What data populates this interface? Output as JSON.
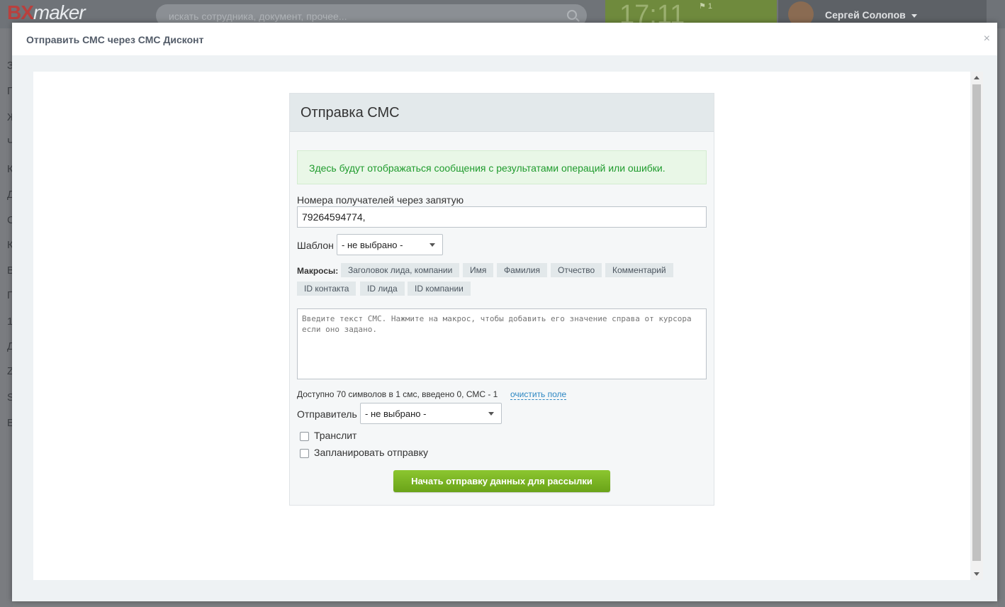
{
  "background": {
    "logo": {
      "bx": "BX",
      "maker": "maker"
    },
    "search_placeholder": "искать сотрудника, документ, прочее...",
    "clock": {
      "time": "17:11",
      "flag_count": "1"
    },
    "user_name": "Сергей Солопов",
    "left_nav_letters": [
      "З",
      "П",
      "Ж",
      "Ч",
      "К",
      "Д",
      "С",
      "К",
      "В",
      "П",
      "1",
      "Д",
      "Z",
      "S",
      "E"
    ]
  },
  "modal": {
    "title": "Отправить СМС через СМС Дисконт",
    "close_icon": "×"
  },
  "panel": {
    "heading": "Отправка СМС",
    "alert_text": "Здесь будут отображаться сообщения с результатами операций или ошибки.",
    "recipients_label": "Номера получателей через запятую",
    "recipients_value": "79264594774,",
    "template_label": "Шаблон",
    "template_value": "- не выбрано -",
    "macros_label": "Макросы:",
    "macros": [
      "Заголовок лида, компании",
      "Имя",
      "Фамилия",
      "Отчество",
      "Комментарий",
      "ID контакта",
      "ID лида",
      "ID компании"
    ],
    "sms_placeholder": "Введите текст СМС. Нажмите на макрос, чтобы добавить его значение справа от курсора если оно задано.",
    "counter_text": "Доступно 70 символов в 1 смс, введено 0, СМС - 1",
    "clear_link": "очистить поле",
    "sender_label": "Отправитель",
    "sender_value": "- не выбрано -",
    "translit_label": "Транслит",
    "translit_checked": false,
    "schedule_label": "Запланировать отправку",
    "schedule_checked": false,
    "submit_label": "Начать отправку данных для рассылки"
  },
  "colors": {
    "accent_green": "#7ab527",
    "alert_text": "#1f9b2d",
    "link": "#2d87c3"
  }
}
